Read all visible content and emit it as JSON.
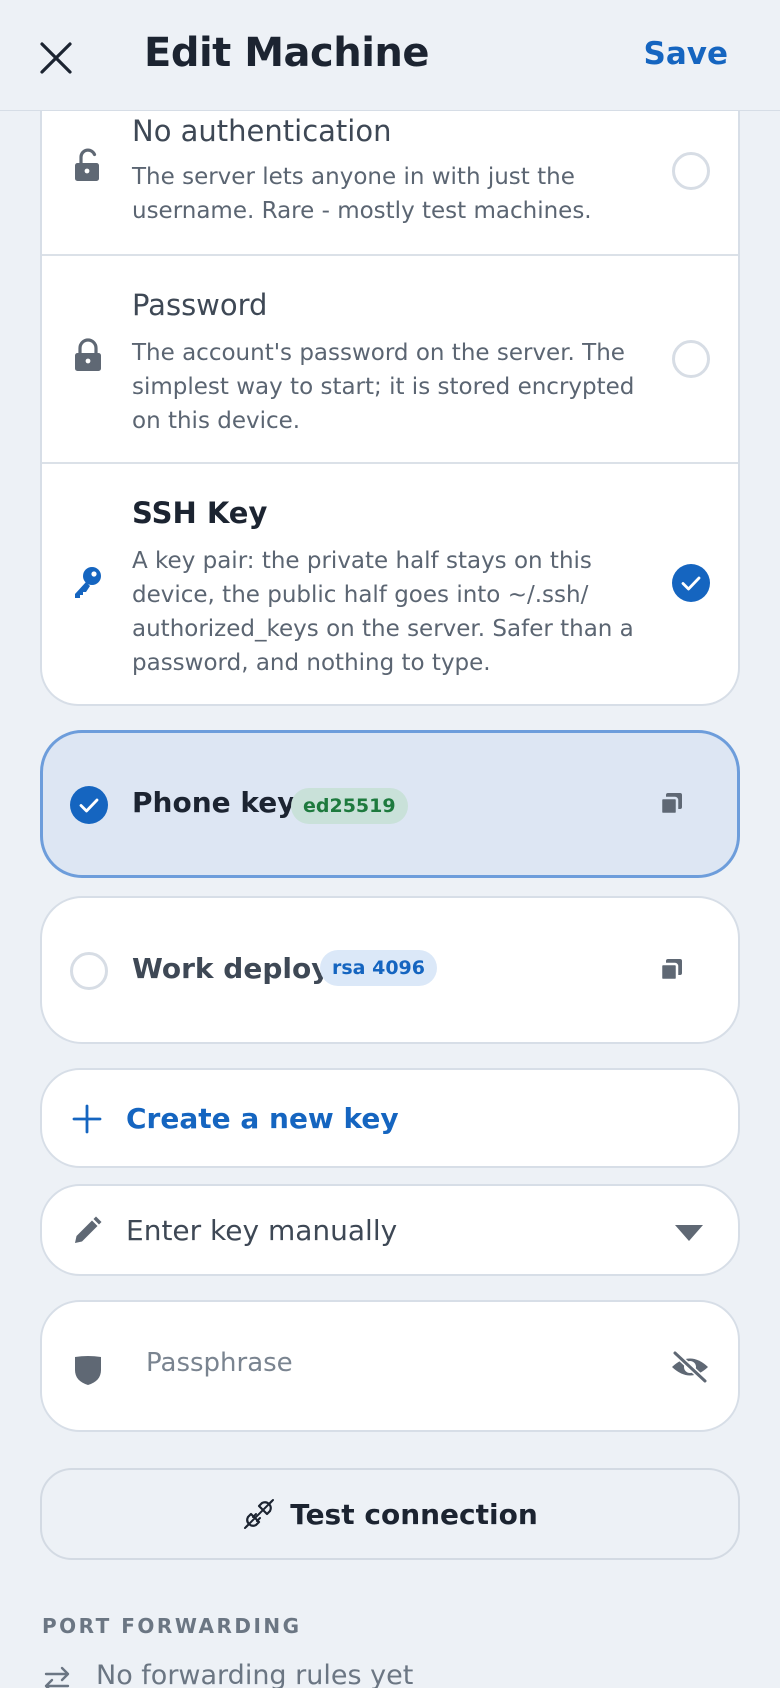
{
  "header": {
    "title": "Edit Machine",
    "save_label": "Save"
  },
  "auth_options": [
    {
      "title": "No authentication",
      "description": "The server lets anyone in with just the username. Rare - mostly test machines.",
      "icon": "lock-open-icon",
      "selected": false
    },
    {
      "title": "Password",
      "description": "The account's password on the server. The simplest way to start; it is stored encrypted on this device.",
      "icon": "lock-icon",
      "selected": false
    },
    {
      "title": "SSH Key",
      "description": "A key pair: the private half stays on this device, the public half goes into ~/.ssh/ authorized_keys on the server. Safer than a password, and nothing to type.",
      "icon": "key-icon",
      "selected": true
    }
  ],
  "keys": [
    {
      "name": "Phone key",
      "type": "ed25519",
      "selected": true
    },
    {
      "name": "Work deploy",
      "type": "rsa 4096",
      "selected": false
    }
  ],
  "create_key_label": "Create a new key",
  "manual_key_label": "Enter key manually",
  "passphrase": {
    "placeholder": "Passphrase",
    "value": ""
  },
  "test_connection_label": "Test connection",
  "port_forwarding": {
    "section_label": "PORT FORWARDING",
    "empty_text": "No forwarding rules yet"
  },
  "colors": {
    "accent": "#1565c0",
    "background": "#edf1f6",
    "badge_green_bg": "#c9e1d9",
    "badge_green_text": "#1e7a3e",
    "selected_card_bg": "#dde6f3"
  }
}
